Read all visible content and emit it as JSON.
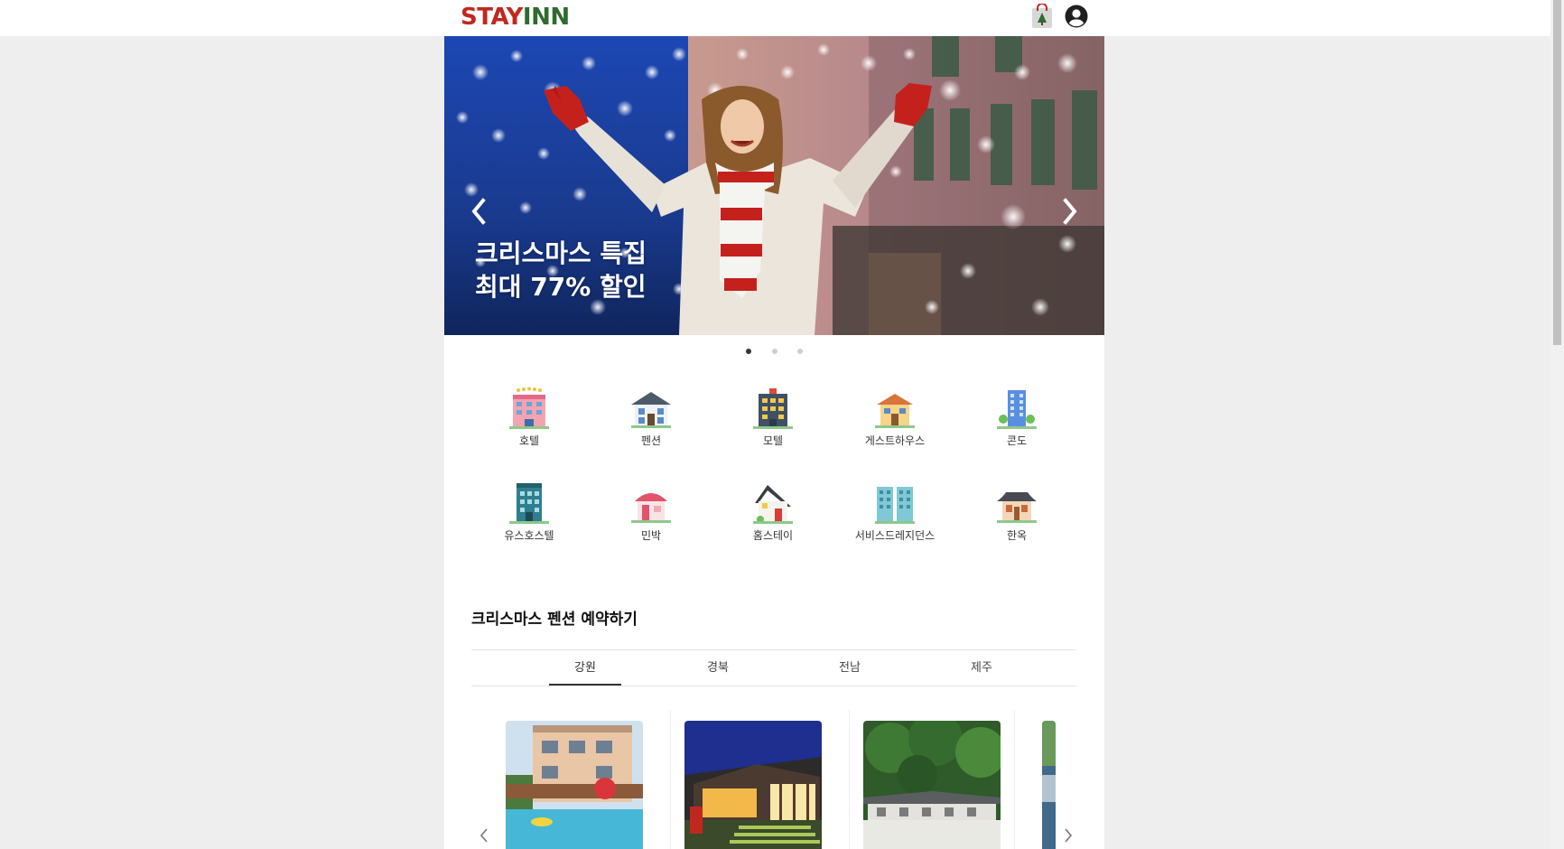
{
  "header": {
    "logo_part1": "STAY",
    "logo_part2": "INN",
    "colors": {
      "logo_red": "#c0281f",
      "logo_green": "#2f6b2f"
    }
  },
  "banner": {
    "caption_line1": "크리스마스 특집",
    "caption_line2": "최대 77% 할인",
    "slide_count": 3,
    "active_slide": 1
  },
  "categories": [
    {
      "label": "호텔",
      "icon": "hotel-icon"
    },
    {
      "label": "펜션",
      "icon": "pension-icon"
    },
    {
      "label": "모텔",
      "icon": "motel-icon"
    },
    {
      "label": "게스트하우스",
      "icon": "guesthouse-icon"
    },
    {
      "label": "콘도",
      "icon": "condo-icon"
    },
    {
      "label": "유스호스텔",
      "icon": "youth-hostel-icon"
    },
    {
      "label": "민박",
      "icon": "minbak-icon"
    },
    {
      "label": "홈스테이",
      "icon": "homestay-icon"
    },
    {
      "label": "서비스드레지던스",
      "icon": "serviced-residence-icon"
    },
    {
      "label": "한옥",
      "icon": "hanok-icon"
    }
  ],
  "section": {
    "title": "크리스마스 펜션 예약하기",
    "tabs": [
      {
        "label": "강원",
        "active": true
      },
      {
        "label": "경북",
        "active": false
      },
      {
        "label": "전남",
        "active": false
      },
      {
        "label": "제주",
        "active": false
      }
    ]
  }
}
